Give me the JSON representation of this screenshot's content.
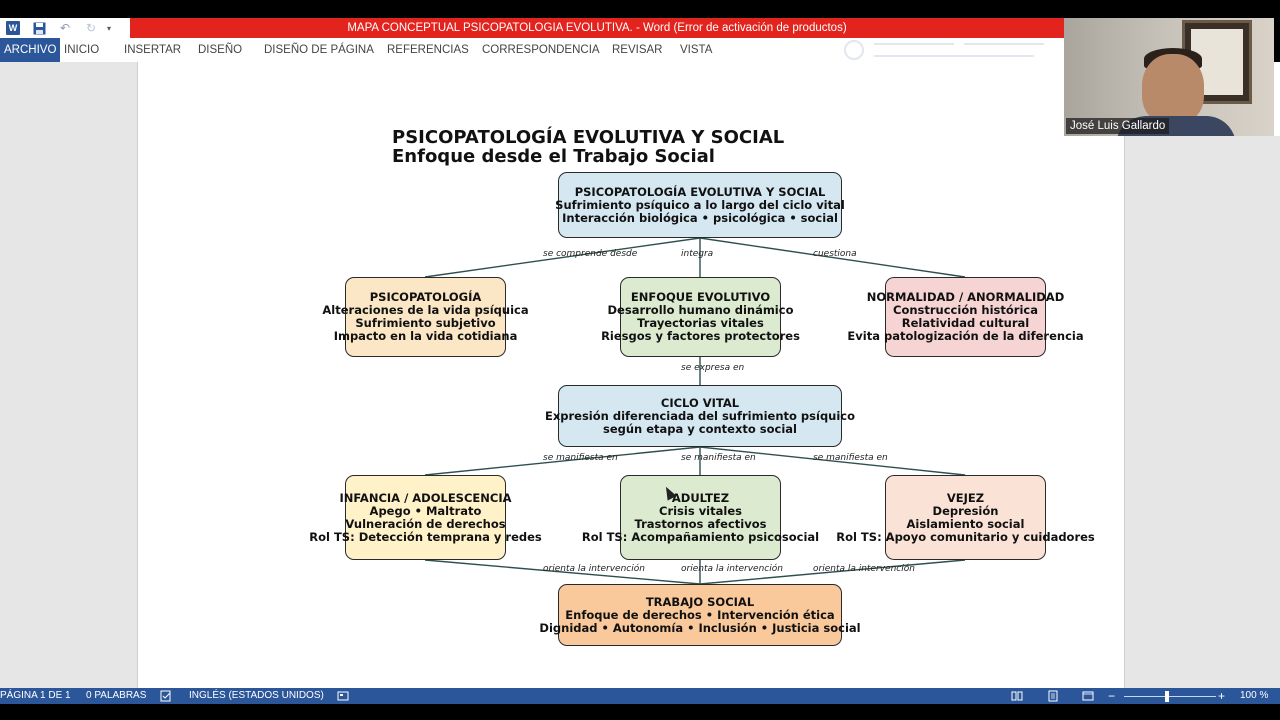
{
  "window": {
    "title": "MAPA CONCEPTUAL  PSICOPATOLOGIA EVOLUTIVA. -  Word (Error de activación de productos)",
    "accent": "#2b579a",
    "title_bar_color": "#e3231d"
  },
  "quick_access": {
    "icons": [
      "word-icon",
      "save-icon",
      "undo-icon",
      "redo-icon",
      "customize-icon"
    ],
    "word_letter": "W"
  },
  "ribbon": {
    "tabs": [
      {
        "label": "ARCHIVO",
        "active": true
      },
      {
        "label": "INICIO"
      },
      {
        "label": "INSERTAR"
      },
      {
        "label": "DISEÑO"
      },
      {
        "label": "DISEÑO DE PÁGINA"
      },
      {
        "label": "REFERENCIAS"
      },
      {
        "label": "CORRESPONDENCIA"
      },
      {
        "label": "REVISAR"
      },
      {
        "label": "VISTA"
      }
    ]
  },
  "document": {
    "title_line1": "PSICOPATOLOGÍA EVOLUTIVA Y SOCIAL",
    "title_line2": "Enfoque desde el Trabajo Social",
    "nodes": {
      "main": [
        "PSICOPATOLOGÍA EVOLUTIVA Y SOCIAL",
        "Sufrimiento psíquico a lo largo del ciclo vital",
        "Interacción biológica • psicológica • social"
      ],
      "psicopatologia": [
        "PSICOPATOLOGÍA",
        "Alteraciones de la vida psíquica",
        "Sufrimiento subjetivo",
        "Impacto en la vida cotidiana"
      ],
      "enfoque": [
        "ENFOQUE EVOLUTIVO",
        "Desarrollo humano dinámico",
        "Trayectorias vitales",
        "Riesgos y factores protectores"
      ],
      "normalidad": [
        "NORMALIDAD / ANORMALIDAD",
        "Construcción histórica",
        "Relatividad cultural",
        "Evita patologización de la diferencia"
      ],
      "ciclo": [
        "CICLO VITAL",
        "Expresión diferenciada del sufrimiento psíquico",
        "según etapa y contexto social"
      ],
      "infancia": [
        "INFANCIA / ADOLESCENCIA",
        "Apego • Maltrato",
        "Vulneración de derechos",
        "Rol TS: Detección temprana y redes"
      ],
      "adultez": [
        "ADULTEZ",
        "Crisis vitales",
        "Trastornos afectivos",
        "Rol TS: Acompañamiento psicosocial"
      ],
      "vejez": [
        "VEJEZ",
        "Depresión",
        "Aislamiento social",
        "Rol TS: Apoyo comunitario y cuidadores"
      ],
      "trabajo": [
        "TRABAJO SOCIAL",
        "Enfoque de derechos • Intervención ética",
        "Dignidad • Autonomía • Inclusión • Justicia social"
      ]
    },
    "edges": {
      "comprende": "se comprende desde",
      "integra": "integra",
      "cuestiona": "cuestiona",
      "expresa": "se expresa en",
      "manifiesta": "se manifiesta en",
      "orienta": "orienta la intervención"
    }
  },
  "video": {
    "name": "José Luis Gallardo"
  },
  "status_bar": {
    "page": "PÁGINA 1 DE 1",
    "words": "0 PALABRAS",
    "language": "INGLÉS (ESTADOS UNIDOS)",
    "zoom": "100 %",
    "zoom_minus": "−",
    "zoom_plus": "+",
    "zoom_fraction": 0.5
  }
}
